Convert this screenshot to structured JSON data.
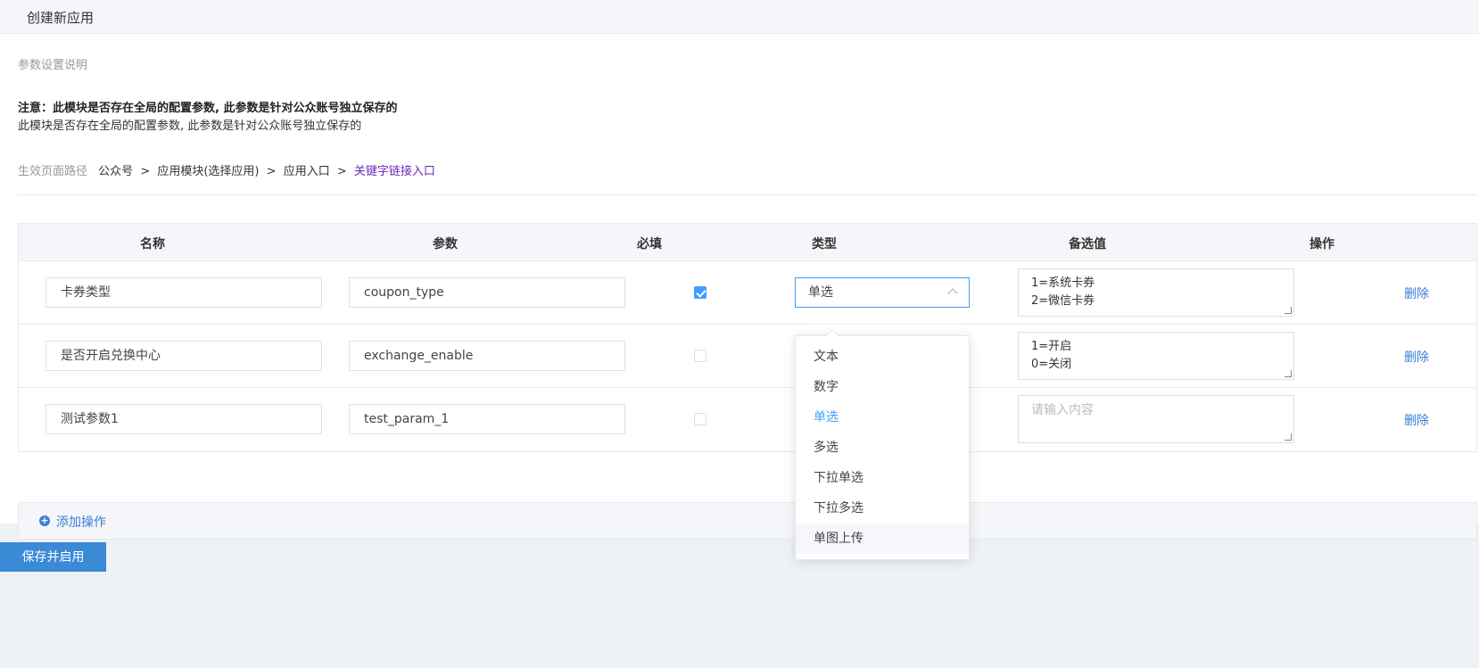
{
  "header": {
    "title": "创建新应用"
  },
  "description": {
    "title": "参数设置说明",
    "notice_bold": "注意：此模块是否存在全局的配置参数, 此参数是针对公众账号独立保存的",
    "notice_text": "此模块是否存在全局的配置参数, 此参数是针对公众账号独立保存的"
  },
  "path": {
    "label": "生效页面路径",
    "parts": [
      "公众号",
      "应用模块(选择应用)",
      "应用入口"
    ],
    "separator": ">",
    "current": "关键字链接入口"
  },
  "table": {
    "headers": [
      "名称",
      "参数",
      "必填",
      "类型",
      "备选值",
      "操作"
    ],
    "rows": [
      {
        "name": "卡券类型",
        "param": "coupon_type",
        "required": true,
        "type": "单选",
        "options": [
          "1=系统卡券",
          "2=微信卡券"
        ],
        "action": "删除"
      },
      {
        "name": "是否开启兑换中心",
        "param": "exchange_enable",
        "required": false,
        "type": "",
        "options": [
          "1=开启",
          "0=关闭"
        ],
        "action": "删除"
      },
      {
        "name": "测试参数1",
        "param": "test_param_1",
        "required": false,
        "type": "",
        "options": [],
        "options_placeholder": "请输入内容",
        "action": "删除"
      }
    ]
  },
  "add_action": {
    "label": "添加操作"
  },
  "save_button": {
    "label": "保存并启用"
  },
  "type_dropdown": {
    "items": [
      "文本",
      "数字",
      "单选",
      "多选",
      "下拉单选",
      "下拉多选",
      "单图上传"
    ],
    "selected": "单选",
    "hovered": "单图上传"
  },
  "colors": {
    "accent": "#409eff",
    "link": "#3a7fd5",
    "path_current": "#6a2bb5",
    "button": "#3a8ad6"
  }
}
